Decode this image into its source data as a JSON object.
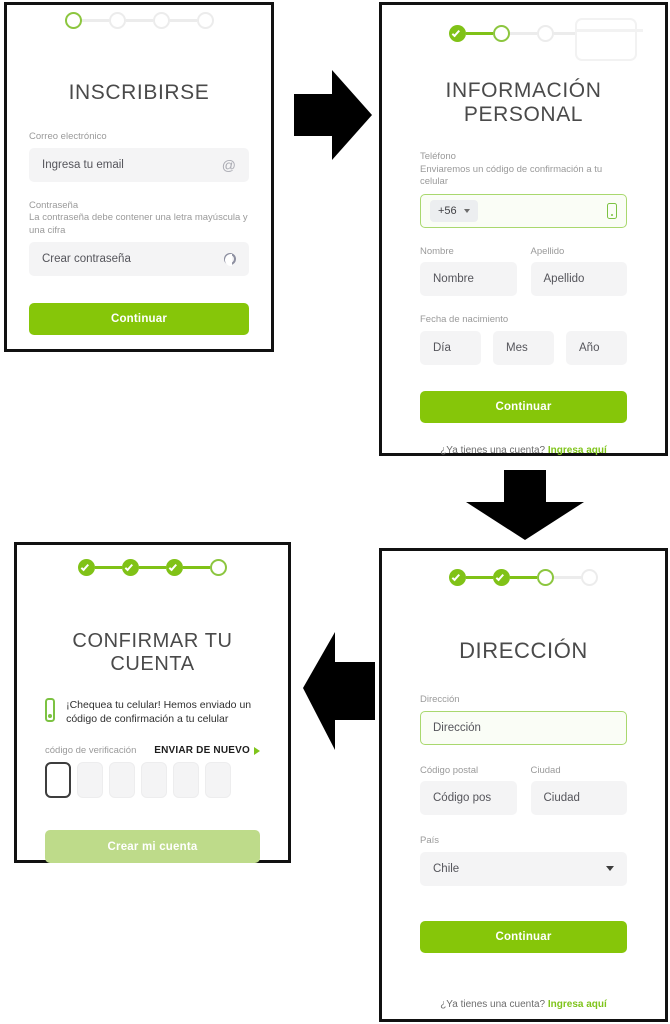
{
  "theme": {
    "brand_green": "#86C609",
    "brand_green_light": "#bedb8a",
    "step_green": "#80C217",
    "field_bg": "#f4f4f5",
    "label_gray": "#9a9a9a",
    "border_black": "#111111"
  },
  "panels": {
    "signup": {
      "name": "inscribirse",
      "title": "INSCRIBIRSE",
      "stepper": {
        "steps": [
          "current",
          "todo",
          "todo",
          "todo"
        ]
      },
      "email": {
        "label": "Correo electrónico",
        "placeholder": "Ingresa tu email",
        "icon": "at-icon"
      },
      "password": {
        "label": "Contraseña",
        "hint": "La contraseña debe contener una letra mayúscula y una cifra",
        "placeholder": "Crear contraseña",
        "icon": "eye-icon"
      },
      "submit": "Continuar"
    },
    "personal": {
      "name": "informacion-personal",
      "title": "INFORMACIÓN PERSONAL",
      "stepper": {
        "steps": [
          "done",
          "current",
          "todo",
          "todo"
        ]
      },
      "phone": {
        "label": "Teléfono",
        "hint": "Enviaremos un código de confirmación a tu celular",
        "country_code": "+56",
        "placeholder": "",
        "icon": "phone-icon"
      },
      "first_name": {
        "label": "Nombre",
        "placeholder": "Nombre"
      },
      "last_name": {
        "label": "Apellido",
        "placeholder": "Apellido"
      },
      "birth": {
        "label": "Fecha de nacimiento",
        "day": "Día",
        "month": "Mes",
        "year": "Año"
      },
      "submit": "Continuar",
      "login_prompt": "¿Ya tienes una cuenta?",
      "login_link": "Ingresa aquí"
    },
    "address": {
      "name": "direccion",
      "title": "DIRECCIÓN",
      "stepper": {
        "steps": [
          "done",
          "done",
          "current",
          "todo"
        ]
      },
      "street": {
        "label": "Dirección",
        "placeholder": "Dirección"
      },
      "zip": {
        "label": "Código postal",
        "placeholder": "Código pos"
      },
      "city": {
        "label": "Ciudad",
        "placeholder": "Ciudad"
      },
      "country": {
        "label": "País",
        "value": "Chile"
      },
      "submit": "Continuar",
      "login_prompt": "¿Ya tienes una cuenta?",
      "login_link": "Ingresa aquí"
    },
    "confirm": {
      "name": "confirmar-tu-cuenta",
      "title": "CONFIRMAR TU CUENTA",
      "stepper": {
        "steps": [
          "done",
          "done",
          "done",
          "current"
        ]
      },
      "notice": "¡Chequea tu celular! Hemos enviado un código de confirmación a tu celular",
      "code_label": "código de verificación",
      "resend_label": "ENVIAR DE NUEVO",
      "code_boxes": 6,
      "code_values": [
        "",
        "",
        "",
        "",
        "",
        ""
      ],
      "submit": "Crear mi cuenta"
    }
  },
  "flow_arrows": [
    {
      "name": "arrow-signup-to-personal",
      "direction": "right"
    },
    {
      "name": "arrow-personal-to-address",
      "direction": "down"
    },
    {
      "name": "arrow-address-to-confirm",
      "direction": "left"
    }
  ]
}
